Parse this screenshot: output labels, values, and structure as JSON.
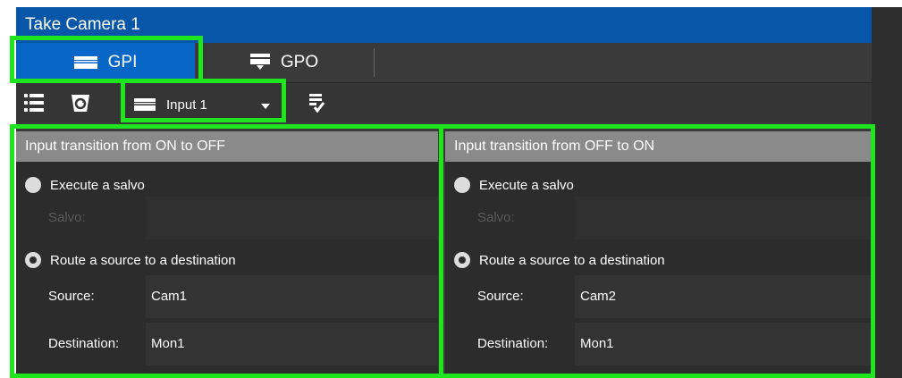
{
  "window": {
    "title": "Take Camera 1"
  },
  "tabs": [
    {
      "label": "GPI",
      "icon": "gpi-icon",
      "active": true
    },
    {
      "label": "GPO",
      "icon": "gpo-icon",
      "active": false
    }
  ],
  "toolbar": {
    "list_icon": "list-icon",
    "bucket_icon": "clear-bucket-icon",
    "input_select": {
      "value": "Input 1",
      "icon": "input-icon"
    },
    "apply_icon": "apply-check-icon"
  },
  "panels": {
    "on_to_off": {
      "header": "Input transition from ON to OFF",
      "option_salvo": "Execute a salvo",
      "salvo_label": "Salvo:",
      "salvo_value": "",
      "option_route": "Route a source to a destination",
      "source_label": "Source:",
      "source_value": "Cam1",
      "destination_label": "Destination:",
      "destination_value": "Mon1",
      "selected": "route"
    },
    "off_to_on": {
      "header": "Input transition from OFF to ON",
      "option_salvo": "Execute a salvo",
      "salvo_label": "Salvo:",
      "salvo_value": "",
      "option_route": "Route a source to a destination",
      "source_label": "Source:",
      "source_value": "Cam2",
      "destination_label": "Destination:",
      "destination_value": "Mon1",
      "selected": "route"
    }
  },
  "colors": {
    "title_bar": "#0756a8",
    "active_tab": "#0866c6",
    "highlight": "#1fe51f",
    "panel_header": "#8a8a8a"
  }
}
